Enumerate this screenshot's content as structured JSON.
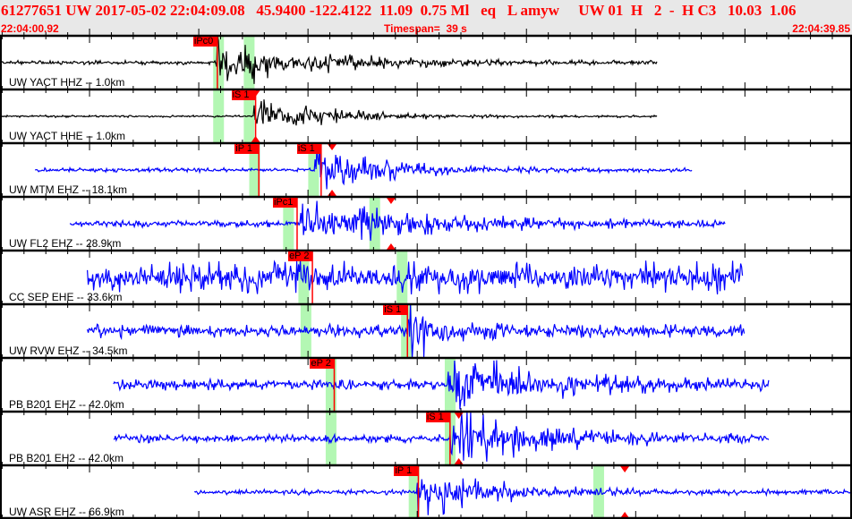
{
  "header": {
    "title": "61277651 UW 2017-05-02 22:04:09.08   45.9400 -122.4122  11.09  0.75 Ml   eq   L amyw     UW 01  H   2  -  H C3   10.03  1.06",
    "start_time": "22:04:00.92",
    "timespan": "Timespan=  39 s",
    "end_time": "22:04:39.85"
  },
  "timespan_s": 39,
  "colors": {
    "pick": "#ff0000",
    "window": "#b3f7b3",
    "trace_black": "#000000",
    "trace_blue": "#0000ff"
  },
  "channels": [
    {
      "label": "UW YACT HHZ -- 1.0km",
      "color": "#000000",
      "start": 0,
      "end": 30.1,
      "noise": 1.5,
      "onset": 9.9,
      "amp": 22,
      "decay": 4,
      "windows": [
        9.8,
        11.2
      ],
      "picks": [
        {
          "label": "iPc0",
          "t": 9.95
        }
      ],
      "markers": []
    },
    {
      "label": "UW YACT HHE -- 1.0km",
      "color": "#000000",
      "start": 0,
      "end": 30.1,
      "noise": 0.8,
      "onset": 11.6,
      "amp": 18,
      "decay": 3,
      "windows": [
        9.8,
        11.2
      ],
      "picks": [
        {
          "label": "iS 1",
          "t": 11.7
        }
      ],
      "markers": [
        11.7
      ]
    },
    {
      "label": "UW MTM EHZ -- 18.1km",
      "color": "#0000ff",
      "start": 1.6,
      "end": 31.7,
      "noise": 1.5,
      "onset": 14.4,
      "amp": 20,
      "decay": 3,
      "windows": [
        11.45,
        14.15
      ],
      "picks": [
        {
          "label": "iP 1",
          "t": 11.85
        },
        {
          "label": "iS 1",
          "t": 14.7
        }
      ],
      "markers": [
        15.2
      ]
    },
    {
      "label": "UW FL2 EHZ -- 28.9km",
      "color": "#0000ff",
      "start": 3.2,
      "end": 33.2,
      "noise": 2.5,
      "onset": 13.7,
      "amp": 20,
      "decay": 5,
      "windows": [
        13.0,
        16.95
      ],
      "picks": [
        {
          "label": "iPc1",
          "t": 13.6
        }
      ],
      "markers": [
        17.9
      ]
    },
    {
      "label": "CC SEP EHE -- 33.6km",
      "color": "#0000ff",
      "start": 4.0,
      "end": 34.0,
      "noise": 12,
      "onset": 99,
      "amp": 0,
      "decay": 1,
      "windows": [
        13.7,
        18.2
      ],
      "picks": [
        {
          "label": "eP 2",
          "t": 14.3
        }
      ],
      "markers": []
    },
    {
      "label": "UW RVW EHZ -- 34.5km",
      "color": "#0000ff",
      "start": 4.0,
      "end": 34.1,
      "noise": 5,
      "onset": 18.6,
      "amp": 26,
      "decay": 1.2,
      "windows": [
        13.8,
        18.4
      ],
      "picks": [
        {
          "label": "iS 1",
          "t": 18.65
        }
      ],
      "markers": []
    },
    {
      "label": "PB B201 EHZ -- 42.0km",
      "color": "#0000ff",
      "start": 5.2,
      "end": 35.2,
      "noise": 4,
      "onset": 20.5,
      "amp": 24,
      "decay": 4,
      "windows": [
        14.95,
        20.4
      ],
      "picks": [
        {
          "label": "eP 2",
          "t": 15.3
        }
      ],
      "markers": []
    },
    {
      "label": "PB B201 EH2 -- 42.0km",
      "color": "#0000ff",
      "start": 5.2,
      "end": 35.2,
      "noise": 3,
      "onset": 20.6,
      "amp": 24,
      "decay": 4,
      "windows": [
        14.95,
        20.4
      ],
      "picks": [
        {
          "label": "iS 1",
          "t": 20.6
        }
      ],
      "markers": [
        21.0
      ]
    },
    {
      "label": "UW ASR EHZ -- 66.9km",
      "color": "#0000ff",
      "start": 8.9,
      "end": 39,
      "noise": 2,
      "onset": 19.1,
      "amp": 22,
      "decay": 3,
      "windows": [
        18.75,
        27.2
      ],
      "picks": [
        {
          "label": "iP 1",
          "t": 19.15
        }
      ],
      "markers": [
        28.6
      ]
    }
  ]
}
